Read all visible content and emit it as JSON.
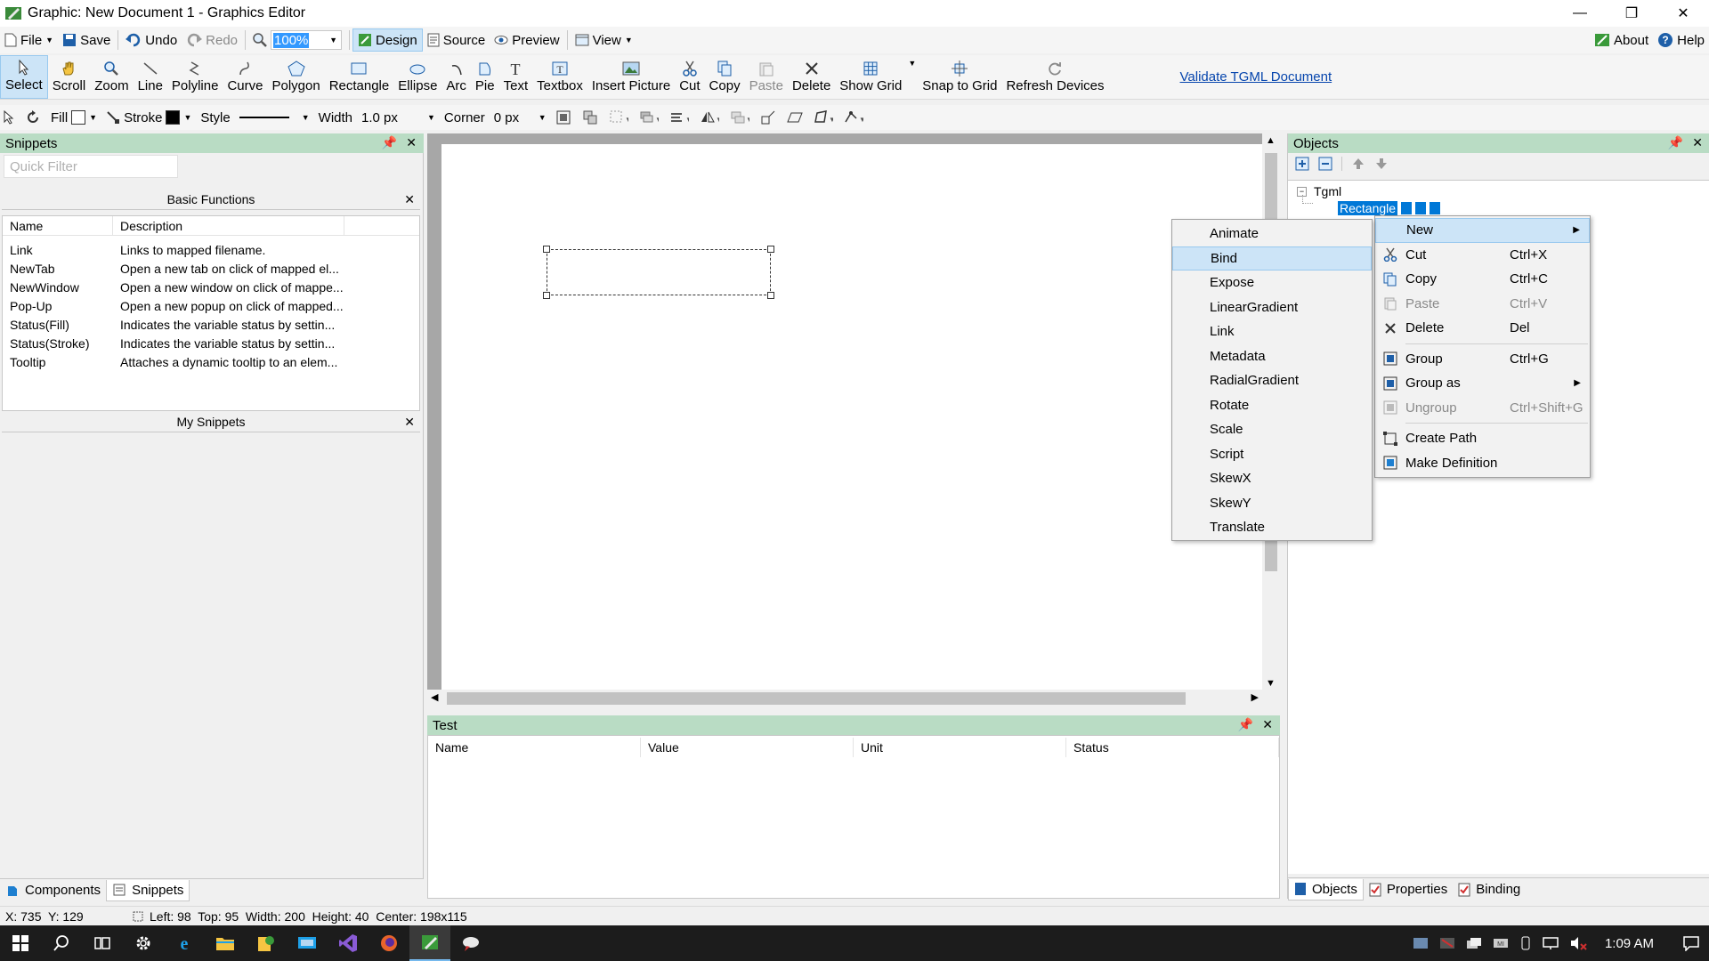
{
  "window": {
    "title": "Graphic: New Document 1 - Graphics Editor",
    "minimize": "—",
    "restore": "❐",
    "close": "✕"
  },
  "toolbar1": {
    "file": "File",
    "save": "Save",
    "undo": "Undo",
    "redo": "Redo",
    "zoom_value": "100%",
    "design": "Design",
    "source": "Source",
    "preview": "Preview",
    "view": "View",
    "about": "About",
    "help": "Help"
  },
  "toolbar2": {
    "tools": [
      {
        "label": "Select",
        "icon": "cursor-icon",
        "active": true
      },
      {
        "label": "Scroll",
        "icon": "hand-icon"
      },
      {
        "label": "Zoom",
        "icon": "magnifier-icon"
      },
      {
        "label": "Line",
        "icon": "line-icon"
      },
      {
        "label": "Polyline",
        "icon": "polyline-icon"
      },
      {
        "label": "Curve",
        "icon": "curve-icon"
      },
      {
        "label": "Polygon",
        "icon": "polygon-icon"
      },
      {
        "label": "Rectangle",
        "icon": "rectangle-icon"
      },
      {
        "label": "Ellipse",
        "icon": "ellipse-icon"
      },
      {
        "label": "Arc",
        "icon": "arc-icon"
      },
      {
        "label": "Pie",
        "icon": "pie-icon"
      },
      {
        "label": "Text",
        "icon": "text-icon"
      },
      {
        "label": "Textbox",
        "icon": "textbox-icon"
      },
      {
        "label": "Insert Picture",
        "icon": "picture-icon"
      },
      {
        "label": "Cut",
        "icon": "scissors-icon"
      },
      {
        "label": "Copy",
        "icon": "copy-icon"
      },
      {
        "label": "Paste",
        "icon": "paste-icon",
        "disabled": true
      },
      {
        "label": "Delete",
        "icon": "delete-icon"
      },
      {
        "label": "Show Grid",
        "icon": "grid-icon"
      },
      {
        "label": "Snap to Grid",
        "icon": "snap-icon"
      },
      {
        "label": "Refresh Devices",
        "icon": "refresh-icon"
      }
    ],
    "validate_link": "Validate TGML Document"
  },
  "toolbar3": {
    "fill": "Fill",
    "stroke": "Stroke",
    "style": "Style",
    "width": "Width",
    "width_value": "1.0 px",
    "corner": "Corner",
    "corner_value": "0 px"
  },
  "snippets": {
    "title": "Snippets",
    "filter_placeholder": "Quick Filter",
    "basic_title": "Basic Functions",
    "columns": [
      "Name",
      "Description"
    ],
    "rows": [
      {
        "name": "Link",
        "desc": "Links to mapped filename."
      },
      {
        "name": "NewTab",
        "desc": "Open a new tab on click of mapped el..."
      },
      {
        "name": "NewWindow",
        "desc": "Open a new window on click of mappe..."
      },
      {
        "name": "Pop-Up",
        "desc": "Open a new popup on click of mapped..."
      },
      {
        "name": "Status(Fill)",
        "desc": "Indicates the variable status by settin..."
      },
      {
        "name": "Status(Stroke)",
        "desc": "Indicates the variable status by settin..."
      },
      {
        "name": "Tooltip",
        "desc": "Attaches a dynamic tooltip to an elem..."
      }
    ],
    "my_title": "My Snippets",
    "tabs": [
      "Components",
      "Snippets"
    ]
  },
  "test": {
    "title": "Test",
    "columns": [
      "Name",
      "Value",
      "Unit",
      "Status"
    ]
  },
  "objects": {
    "title": "Objects",
    "tree_root": "Tgml",
    "tree_child": "Rectangle",
    "tabs": [
      "Objects",
      "Properties",
      "Binding"
    ]
  },
  "context_menu": {
    "items": [
      {
        "label": "New",
        "shortcut": "",
        "submenu": true
      },
      {
        "label": "Cut",
        "shortcut": "Ctrl+X"
      },
      {
        "label": "Copy",
        "shortcut": "Ctrl+C"
      },
      {
        "label": "Paste",
        "shortcut": "Ctrl+V",
        "disabled": true
      },
      {
        "label": "Delete",
        "shortcut": "Del"
      },
      {
        "label": "Group",
        "shortcut": "Ctrl+G"
      },
      {
        "label": "Group as",
        "shortcut": "",
        "submenu": true
      },
      {
        "label": "Ungroup",
        "shortcut": "Ctrl+Shift+G",
        "disabled": true
      },
      {
        "label": "Create Path",
        "shortcut": ""
      },
      {
        "label": "Make Definition",
        "shortcut": ""
      }
    ]
  },
  "submenu": {
    "items": [
      "Animate",
      "Bind",
      "Expose",
      "LinearGradient",
      "Link",
      "Metadata",
      "RadialGradient",
      "Rotate",
      "Scale",
      "Script",
      "SkewX",
      "SkewY",
      "Translate"
    ],
    "highlighted": "Bind"
  },
  "statusbar": {
    "cursor": "X: 735  Y: 129",
    "info": "Left: 98  Top: 95  Width: 200  Height: 40  Center: 198x115"
  },
  "taskbar": {
    "clock": "1:09 AM"
  }
}
